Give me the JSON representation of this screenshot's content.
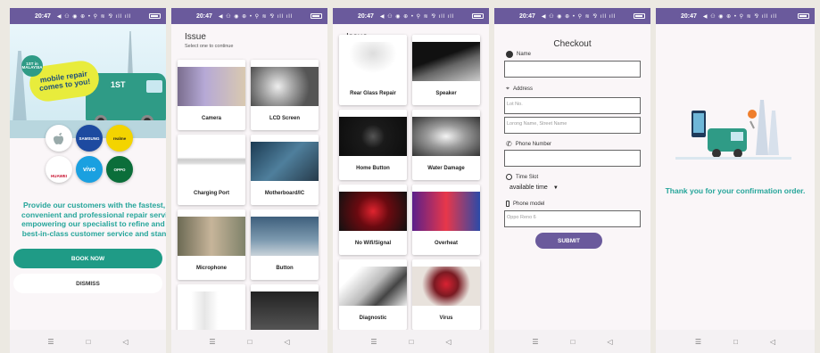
{
  "status": {
    "time": "20:47",
    "icons": "◀ ⚇ ◉ ⊕ •  ⚲ ≋ ⅋ ıll ıll"
  },
  "nav": {
    "menu": "☰",
    "home": "□",
    "back": "◁"
  },
  "screen1": {
    "badge": "1ST in MALAYSIA",
    "banner": "mobile repair comes to you!",
    "van_brand": "1ST",
    "brands": [
      "",
      "SAMSUNG",
      "realme",
      "HUAWEI",
      "vivo",
      "OPPO"
    ],
    "promo_lines": [
      "Provide our customers with the fastest, m",
      "convenient and professional repair service",
      "empowering our specialist to refine and de",
      "best-in-class customer service and standa"
    ],
    "book_now": "BOOK NOW",
    "dismiss": "DISMISS"
  },
  "issue": {
    "title": "Issue",
    "subtitle": "Select one to continue"
  },
  "screen2": {
    "cards": [
      "Camera",
      "LCD Screen",
      "Charging Port",
      "Motherboard/IC",
      "Microphone",
      "Button",
      "",
      ""
    ]
  },
  "screen3": {
    "cards": [
      "Rear Glass Repair",
      "Speaker",
      "Home Button",
      "Water Damage",
      "No Wifi/Signal",
      "Overheat",
      "Diagnostic",
      "Virus"
    ]
  },
  "checkout": {
    "title": "Checkout",
    "name_label": "Name",
    "address_label": "Address",
    "lot_placeholder": "Lot No.",
    "street_placeholder": "Lorong Name, Street Name",
    "phone_label": "Phone Number",
    "timeslot_label": "Time Slot",
    "timeslot_value": "available time",
    "model_label": "Phone model",
    "model_placeholder": "Oppo Reno 6",
    "submit": "SUBMIT"
  },
  "confirm": {
    "message": "Thank you for your confirmation order."
  },
  "colors": {
    "primary": "#6a5a9c",
    "teal": "#1f9b86",
    "text_teal": "#25a59a"
  }
}
